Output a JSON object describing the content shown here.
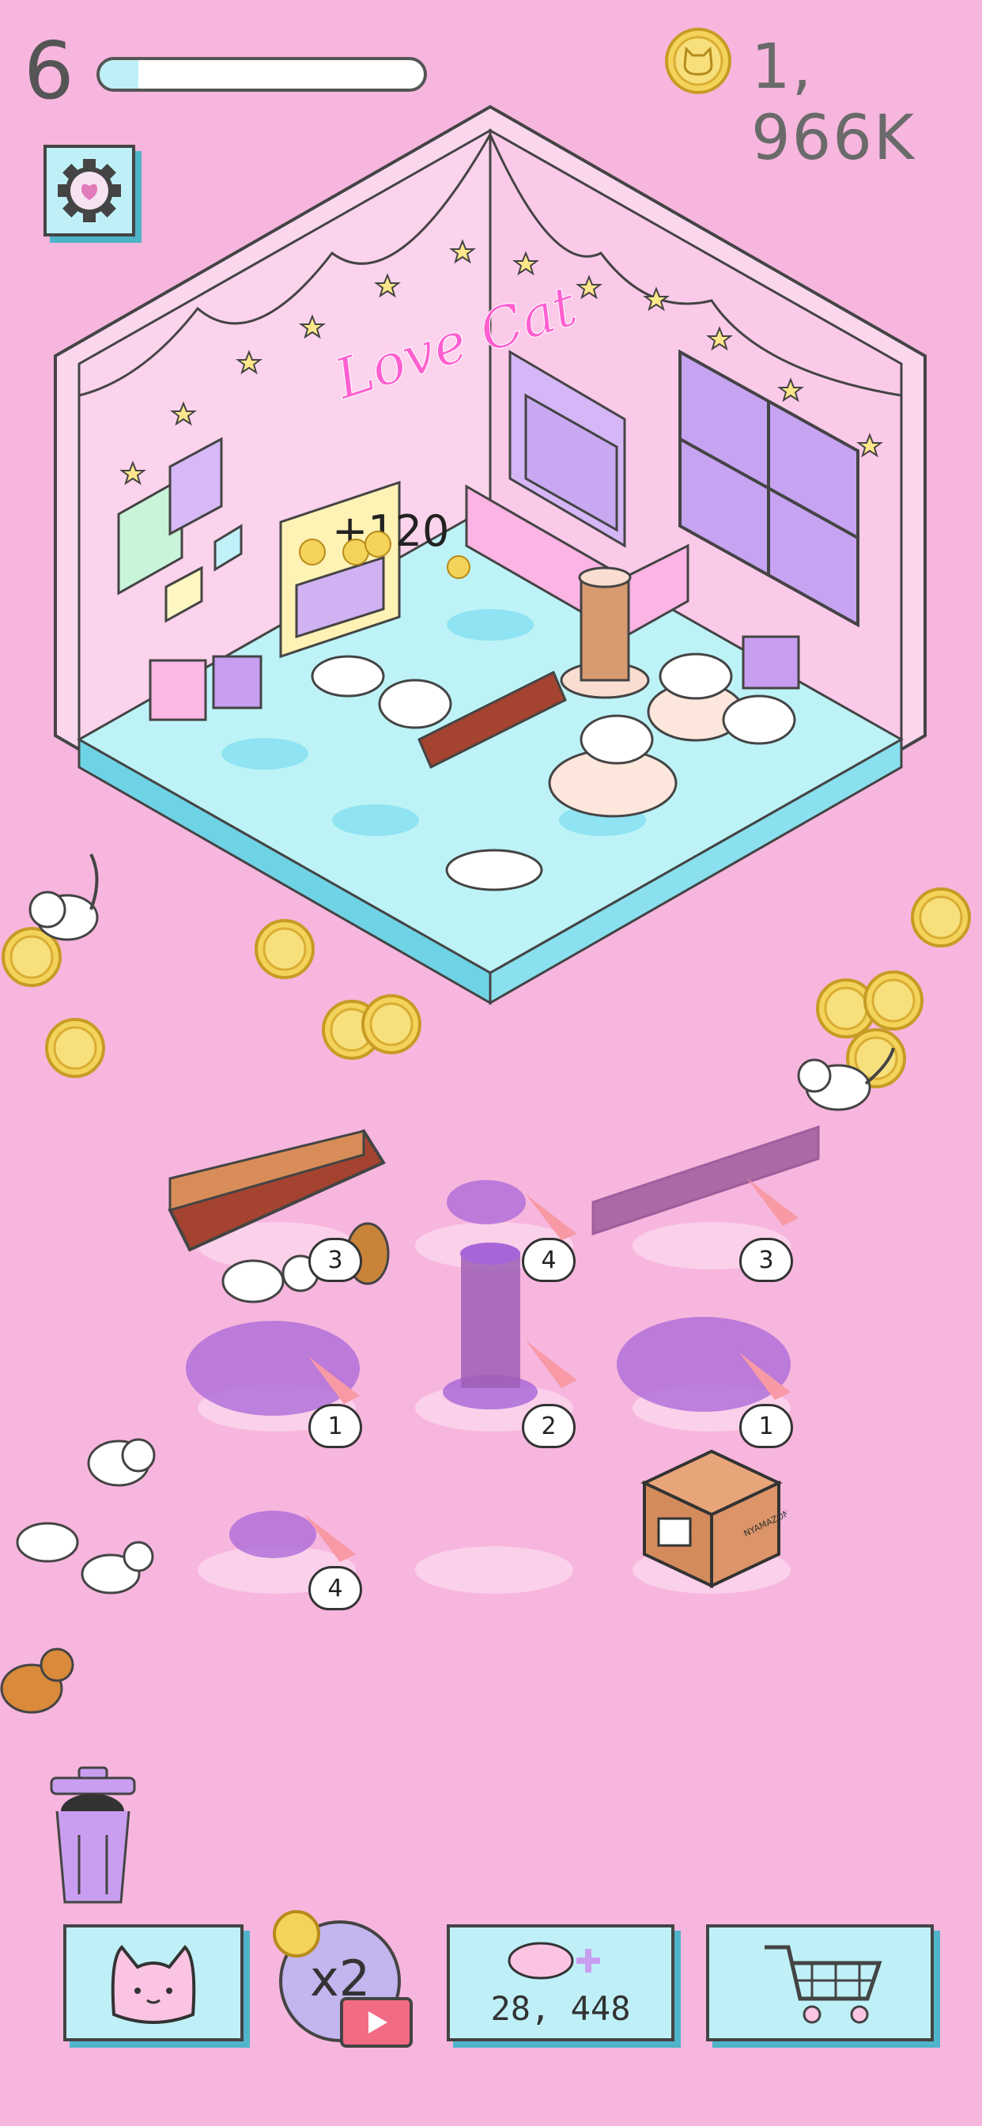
{
  "hud": {
    "level": "6",
    "xp_progress": 0.12,
    "coins": "1, 966K"
  },
  "room": {
    "neon_sign": "Love Cat",
    "float_reward": "+120",
    "box_label": "NYAMAZON"
  },
  "grid": {
    "items": [
      {
        "level": "3"
      },
      {
        "level": "4"
      },
      {
        "level": "3"
      },
      {
        "level": "1"
      },
      {
        "level": "2"
      },
      {
        "level": "1"
      },
      {
        "level": "4"
      }
    ]
  },
  "bottom_bar": {
    "cats_icon": "cat-face-icon",
    "boost_label": "x2",
    "buy_price": "28, 448",
    "shop_icon": "cart-icon"
  },
  "colors": {
    "background": "#f7b6dd",
    "panel": "#bff0f7",
    "panel_shadow": "#4fb3c9",
    "coin": "#f3d35a",
    "floor": "#bdf3f7",
    "wall": "#fbc9e8",
    "purple_locked": "#a865d8"
  }
}
